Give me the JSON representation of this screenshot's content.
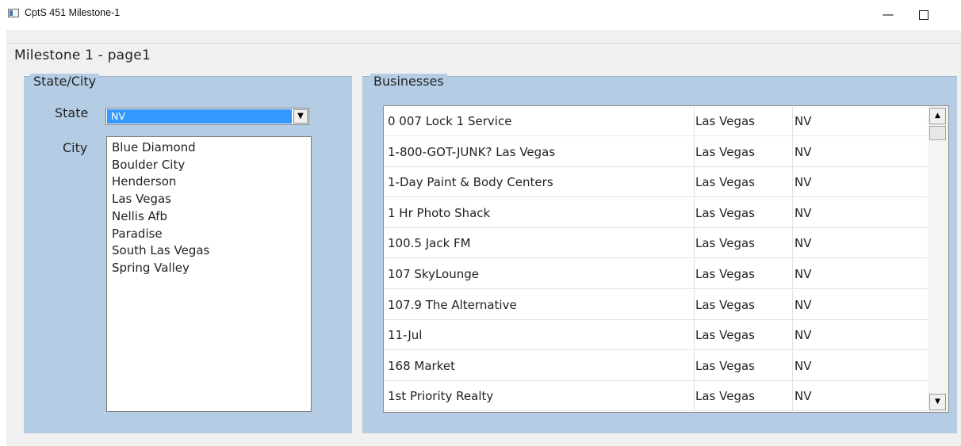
{
  "window": {
    "title": "CptS 451 Milestone-1",
    "minimize_label": "—"
  },
  "tab": {
    "label": "Milestone 1 - page1"
  },
  "state_city_group": {
    "title": "State/City",
    "state_label": "State",
    "state_selected": "NV",
    "city_label": "City",
    "cities": [
      "Blue Diamond",
      "Boulder City",
      "Henderson",
      "Las Vegas",
      "Nellis Afb",
      "Paradise",
      "South Las Vegas",
      "Spring Valley"
    ]
  },
  "businesses_group": {
    "title": "Businesses",
    "rows": [
      [
        "0 007 Lock 1 Service",
        "Las Vegas",
        "NV"
      ],
      [
        "1-800-GOT-JUNK? Las Vegas",
        "Las Vegas",
        "NV"
      ],
      [
        "1-Day Paint & Body Centers",
        "Las Vegas",
        "NV"
      ],
      [
        "1 Hr Photo Shack",
        "Las Vegas",
        "NV"
      ],
      [
        "100.5 Jack FM",
        "Las Vegas",
        "NV"
      ],
      [
        "107 SkyLounge",
        "Las Vegas",
        "NV"
      ],
      [
        "107.9 The Alternative",
        "Las Vegas",
        "NV"
      ],
      [
        "11-Jul",
        "Las Vegas",
        "NV"
      ],
      [
        "168 Market",
        "Las Vegas",
        "NV"
      ],
      [
        "1st Priority Realty",
        "Las Vegas",
        "NV"
      ]
    ]
  },
  "icons": {
    "app": "app-window-icon",
    "dropdown": "chevron-down-icon",
    "scroll_up": "arrow-up-icon",
    "scroll_down": "arrow-down-icon"
  },
  "colors": {
    "group_background": "#b5cde4",
    "selection": "#3399ff",
    "form_background": "#f0f0f0"
  }
}
